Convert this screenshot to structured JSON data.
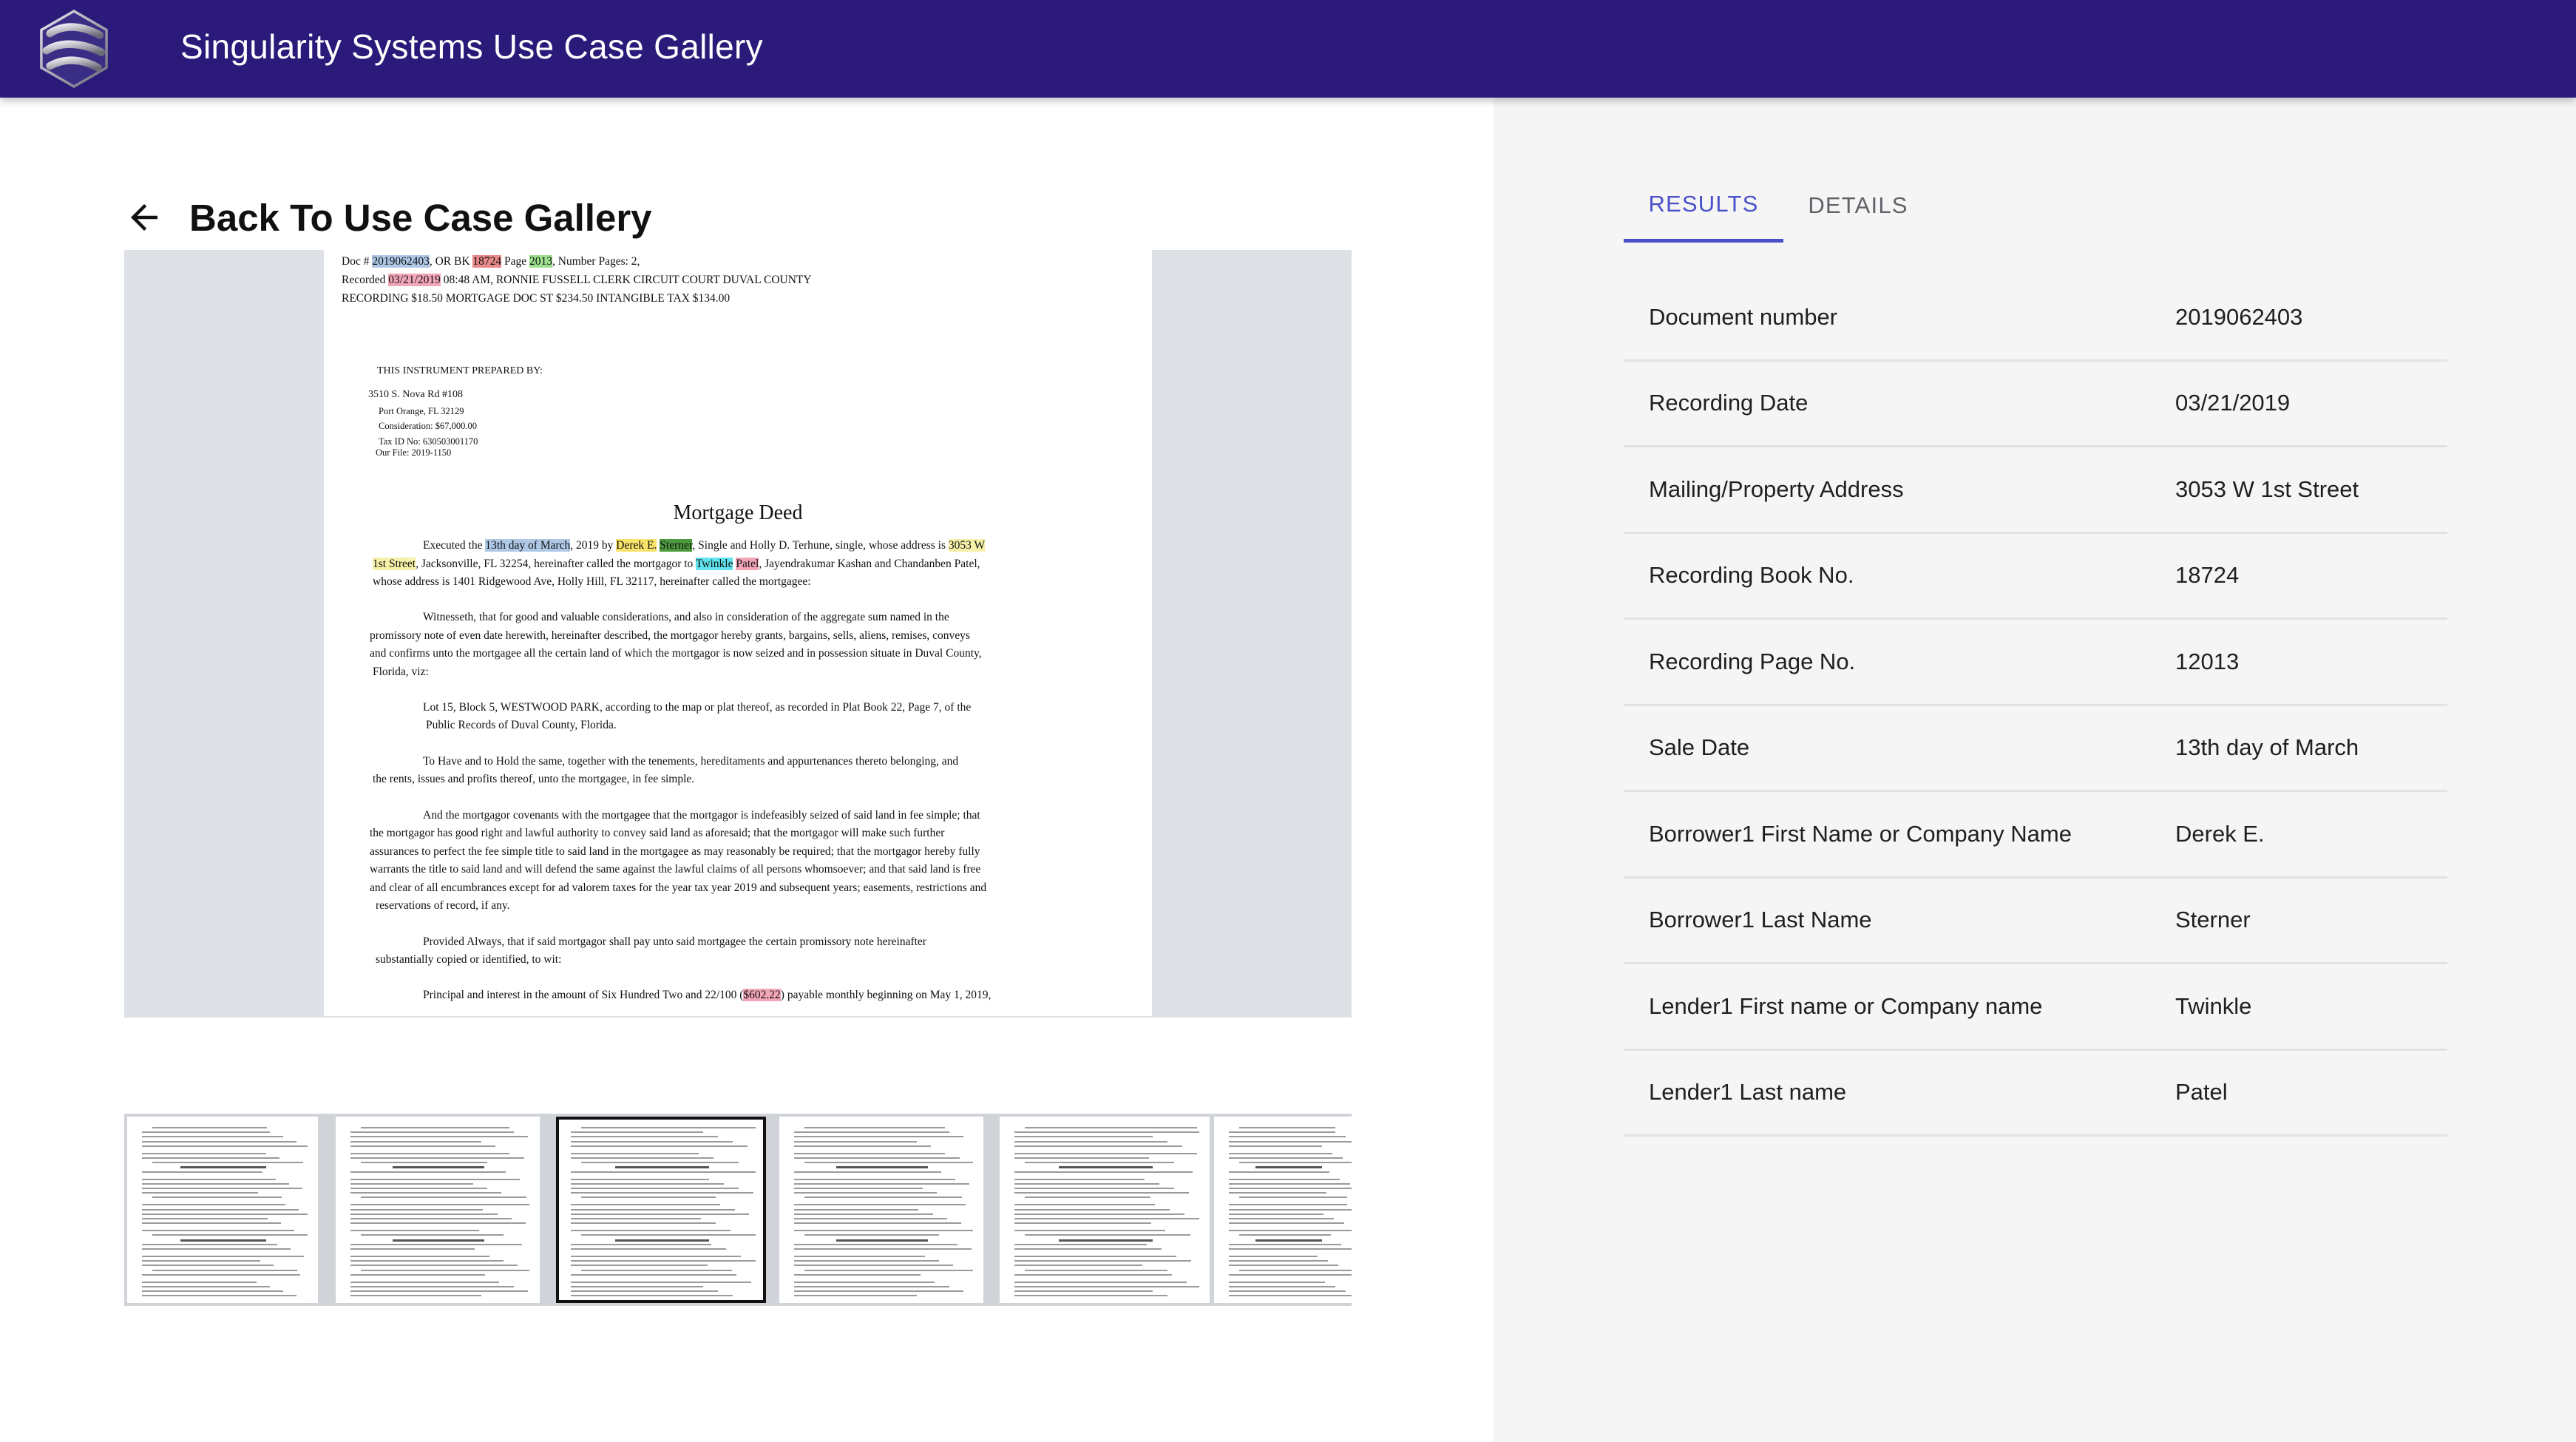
{
  "app": {
    "title": "Singularity Systems Use Case Gallery"
  },
  "nav": {
    "back_label": "Back To Use Case Gallery"
  },
  "document": {
    "header_lines": [
      {
        "segments": [
          {
            "text": "Doc # "
          },
          {
            "text": "2019062403",
            "hl": "hl-blue"
          },
          {
            "text": ", OR BK "
          },
          {
            "text": "18724",
            "hl": "hl-red"
          },
          {
            "text": " Page "
          },
          {
            "text": "2013",
            "hl": "hl-green"
          },
          {
            "text": ", Number Pages: 2,"
          }
        ]
      },
      {
        "segments": [
          {
            "text": "Recorded "
          },
          {
            "text": "03/21/2019",
            "hl": "hl-pink"
          },
          {
            "text": " 08:48 AM, RONNIE FUSSELL CLERK CIRCUIT COURT DUVAL COUNTY"
          }
        ]
      },
      {
        "segments": [
          {
            "text": "RECORDING $18.50 MORTGAGE DOC ST $234.50 INTANGIBLE TAX $134.00"
          }
        ]
      }
    ],
    "prepared_by": [
      "THIS INSTRUMENT PREPARED BY:",
      "3510 S. Nova Rd #108",
      "Port Orange, FL 32129",
      "Consideration: $67,000.00",
      "Tax ID No: 630503001170",
      "Our File: 2019-1150"
    ],
    "heading": "Mortgage Deed",
    "body_lines": [
      {
        "segments": [
          {
            "text": "Executed the "
          },
          {
            "text": "13th day of March",
            "hl": "hl-blue"
          },
          {
            "text": ", 2019 by "
          },
          {
            "text": "Derek E.",
            "hl": "hl-yellow"
          },
          {
            "text": " "
          },
          {
            "text": "Sterner",
            "hl": "hl-dgreen"
          },
          {
            "text": ", Single and Holly D. Terhune, single, whose address is "
          },
          {
            "text": "3053 W",
            "hl": "hl-cream"
          }
        ]
      },
      {
        "segments": [
          {
            "text": "1st Street",
            "hl": "hl-cream"
          },
          {
            "text": ", Jacksonville, FL 32254, hereinafter called the mortgagor to "
          },
          {
            "text": "Twinkle",
            "hl": "hl-cyan"
          },
          {
            "text": " "
          },
          {
            "text": "Patel",
            "hl": "hl-pink"
          },
          {
            "text": ", Jayendrakumar Kashan and Chandanben Patel,"
          }
        ]
      },
      {
        "segments": [
          {
            "text": "whose address is 1401 Ridgewood Ave, Holly Hill, FL 32117, hereinafter called the mortgagee:"
          }
        ]
      },
      {
        "segments": [
          {
            "text": "Witnesseth, that for good and valuable considerations, and also in consideration of the aggregate sum named in the"
          }
        ]
      },
      {
        "segments": [
          {
            "text": "promissory note of even date herewith, hereinafter described, the mortgagor hereby grants, bargains, sells, aliens, remises, conveys"
          }
        ]
      },
      {
        "segments": [
          {
            "text": "and confirms unto the mortgagee all the certain land of which the mortgagor is now seized and in possession situate in Duval County,"
          }
        ]
      },
      {
        "segments": [
          {
            "text": "Florida, viz:"
          }
        ]
      },
      {
        "segments": [
          {
            "text": "Lot 15, Block 5, WESTWOOD PARK, according to the map or plat thereof, as recorded in Plat Book 22, Page 7, of the"
          }
        ]
      },
      {
        "segments": [
          {
            "text": "Public Records of Duval County, Florida."
          }
        ]
      },
      {
        "segments": [
          {
            "text": "To Have and to Hold the same, together with the tenements, hereditaments and appurtenances thereto belonging, and"
          }
        ]
      },
      {
        "segments": [
          {
            "text": "the rents, issues and profits thereof, unto the mortgagee, in fee simple."
          }
        ]
      },
      {
        "segments": [
          {
            "text": "And the mortgagor covenants with the mortgagee that the mortgagor is indefeasibly seized of said land in fee simple; that"
          }
        ]
      },
      {
        "segments": [
          {
            "text": "the mortgagor has good right and lawful authority to convey said land as aforesaid; that the mortgagor will make such further"
          }
        ]
      },
      {
        "segments": [
          {
            "text": "assurances to perfect the fee simple title to said land in the mortgagee as may reasonably be required; that the mortgagor hereby fully"
          }
        ]
      },
      {
        "segments": [
          {
            "text": "warrants the title to said land and will defend the same against the lawful claims of all persons whomsoever; and that said land is free"
          }
        ]
      },
      {
        "segments": [
          {
            "text": "and clear of all encumbrances except for ad valorem taxes for the year tax year 2019 and subsequent years; easements, restrictions and"
          }
        ]
      },
      {
        "segments": [
          {
            "text": "reservations of record, if any."
          }
        ]
      },
      {
        "segments": [
          {
            "text": "Provided Always, that if said mortgagor shall pay unto said mortgagee the certain promissory note hereinafter"
          }
        ]
      },
      {
        "segments": [
          {
            "text": "substantially copied or identified, to wit:"
          }
        ]
      },
      {
        "segments": [
          {
            "text": "Principal and interest in the amount of Six Hundred Two and 22/100 ("
          },
          {
            "text": "$602.22",
            "hl": "hl-pink"
          },
          {
            "text": ") payable monthly beginning on May 1, 2019,"
          }
        ]
      }
    ]
  },
  "tabs": [
    {
      "label": "RESULTS",
      "active": true
    },
    {
      "label": "DETAILS",
      "active": false
    }
  ],
  "results": [
    {
      "key": "Document number",
      "value": "2019062403"
    },
    {
      "key": "Recording Date",
      "value": "03/21/2019"
    },
    {
      "key": "Mailing/Property Address",
      "value": "3053 W 1st Street"
    },
    {
      "key": "Recording Book No.",
      "value": "18724"
    },
    {
      "key": "Recording Page No.",
      "value": "12013"
    },
    {
      "key": "Sale Date",
      "value": "13th day of March"
    },
    {
      "key": "Borrower1 First Name or Company Name",
      "value": "Derek E."
    },
    {
      "key": "Borrower1 Last Name",
      "value": "Sterner"
    },
    {
      "key": "Lender1 First name or Company name",
      "value": "Twinkle"
    },
    {
      "key": "Lender1 Last name",
      "value": "Patel"
    }
  ],
  "colors": {
    "appbar": "#2b1a7a",
    "accent": "#4a50c7",
    "right_pane_bg": "#f5f5f6"
  },
  "icons": {
    "back": "arrow-left-icon",
    "logo": "singularity-logo-icon"
  }
}
